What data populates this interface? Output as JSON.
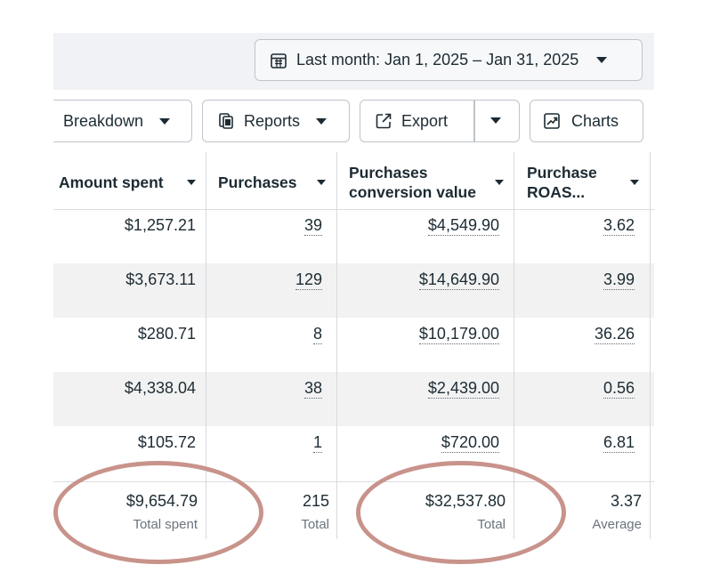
{
  "date_range": {
    "label": "Last month: Jan 1, 2025 – Jan 31, 2025"
  },
  "toolbar": {
    "breakdown_label": "Breakdown",
    "reports_label": "Reports",
    "export_label": "Export",
    "charts_label": "Charts"
  },
  "columns": {
    "amount_spent": "Amount spent",
    "purchases": "Purchases",
    "conversion_value_line1": "Purchases",
    "conversion_value_line2": "conversion value",
    "roas_line1": "Purchase",
    "roas_line2": "ROAS..."
  },
  "rows": [
    {
      "amount_spent": "$1,257.21",
      "purchases": "39",
      "conversion_value": "$4,549.90",
      "roas": "3.62"
    },
    {
      "amount_spent": "$3,673.11",
      "purchases": "129",
      "conversion_value": "$14,649.90",
      "roas": "3.99"
    },
    {
      "amount_spent": "$280.71",
      "purchases": "8",
      "conversion_value": "$10,179.00",
      "roas": "36.26"
    },
    {
      "amount_spent": "$4,338.04",
      "purchases": "38",
      "conversion_value": "$2,439.00",
      "roas": "0.56"
    },
    {
      "amount_spent": "$105.72",
      "purchases": "1",
      "conversion_value": "$720.00",
      "roas": "6.81"
    }
  ],
  "totals": {
    "amount_spent": "$9,654.79",
    "amount_spent_label": "Total spent",
    "purchases": "215",
    "purchases_label": "Total",
    "conversion_value": "$32,537.80",
    "conversion_value_label": "Total",
    "roas": "3.37",
    "roas_label": "Average"
  },
  "colors": {
    "highlight_ellipse": "#c8938b",
    "row_alt": "#f2f2f2",
    "top_band": "#f1f2f5"
  },
  "icons": {
    "date": "calendar-icon",
    "reports": "reports-icon",
    "export": "export-icon",
    "charts": "chart-icon"
  }
}
